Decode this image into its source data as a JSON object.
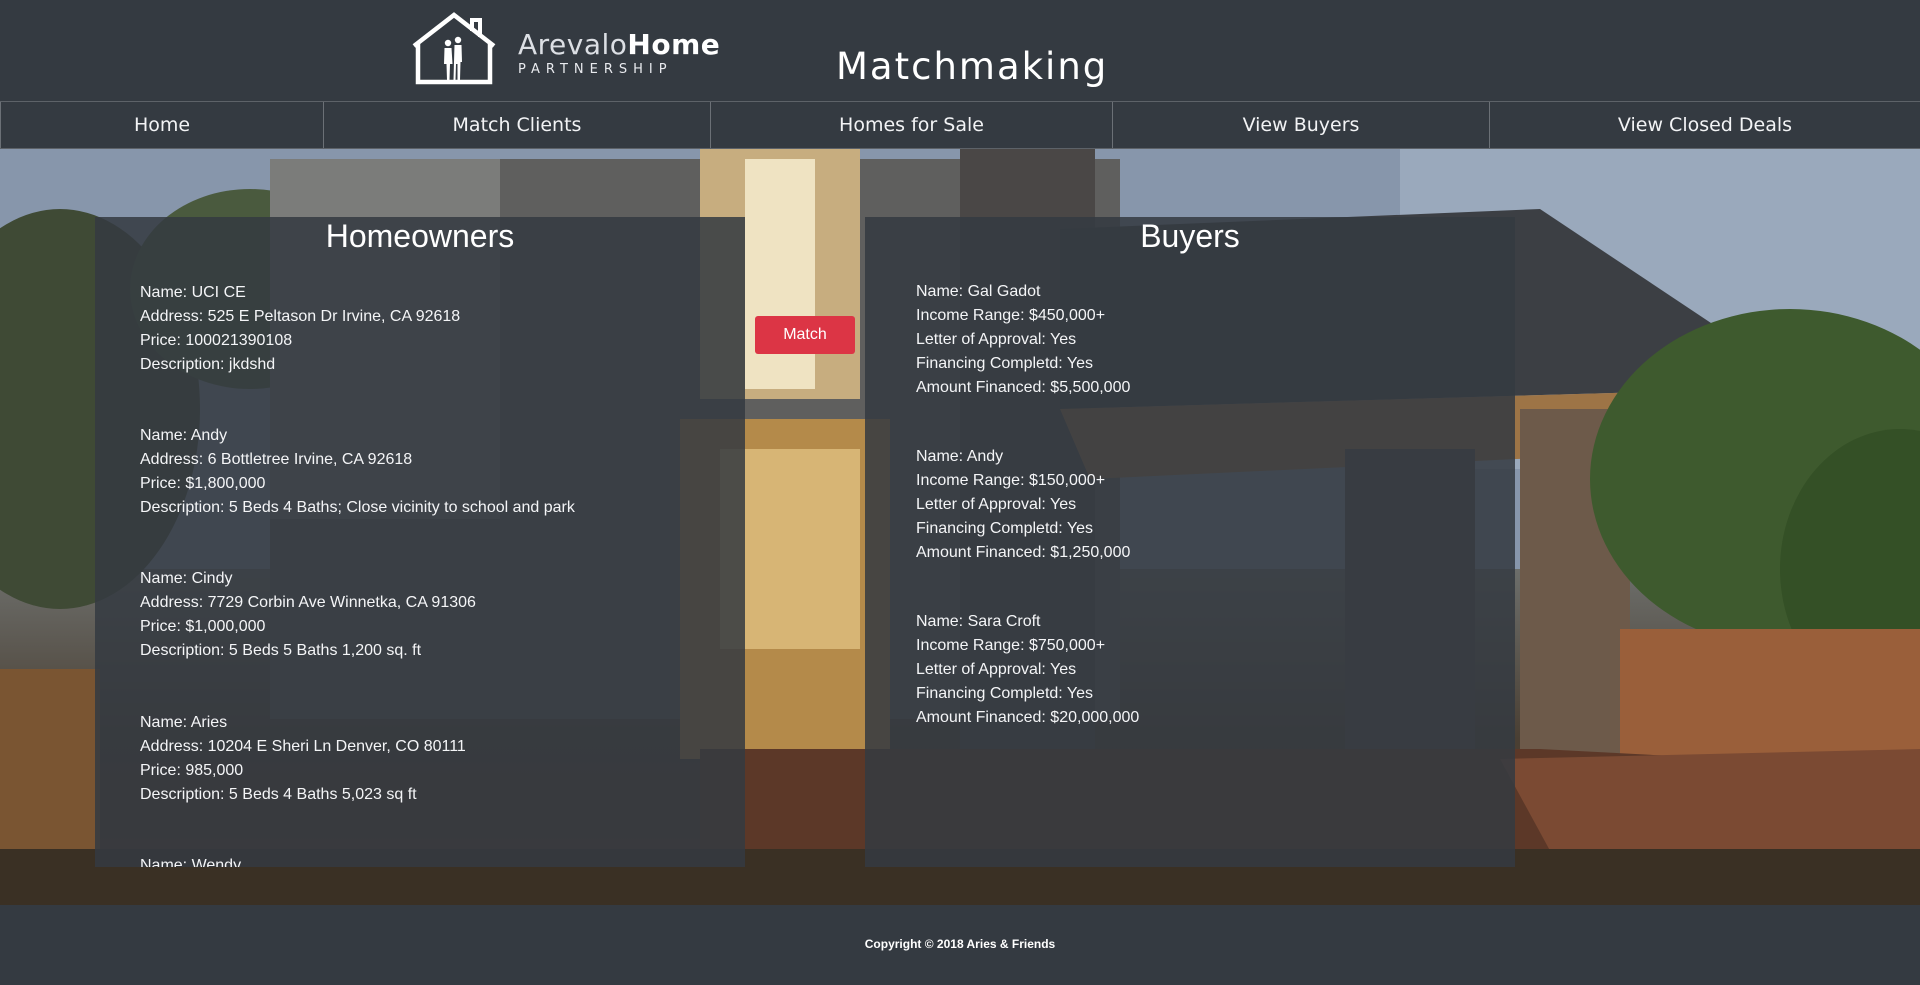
{
  "brand": {
    "logo_name_light": "Arevalo",
    "logo_name_bold": "Home",
    "logo_sub": "PARTNERSHIP",
    "accent": "#dc3545",
    "background": "#343a41"
  },
  "header": {
    "title": "Matchmaking"
  },
  "nav": {
    "items": [
      {
        "label": "Home"
      },
      {
        "label": "Match Clients"
      },
      {
        "label": "Homes for Sale"
      },
      {
        "label": "View Buyers"
      },
      {
        "label": "View Closed Deals"
      }
    ]
  },
  "homeowners": {
    "title": "Homeowners",
    "records": [
      {
        "name": "Name: UCI CE",
        "address": "Address: 525 E Peltason Dr Irvine, CA 92618",
        "price": "Price: 100021390108",
        "description": "Description: jkdshd"
      },
      {
        "name": "Name: Andy",
        "address": "Address: 6 Bottletree Irvine, CA 92618",
        "price": "Price: $1,800,000",
        "description": "Description: 5 Beds 4 Baths; Close vicinity to school and park"
      },
      {
        "name": "Name: Cindy",
        "address": "Address: 7729 Corbin Ave Winnetka, CA 91306",
        "price": "Price: $1,000,000",
        "description": "Description: 5 Beds 5 Baths 1,200 sq. ft"
      },
      {
        "name": "Name: Aries",
        "address": "Address: 10204 E Sheri Ln Denver, CO 80111",
        "price": "Price: 985,000",
        "description": "Description: 5 Beds 4 Baths 5,023 sq ft"
      },
      {
        "name": "Name: Wendy"
      }
    ]
  },
  "match_button": {
    "label": "Match"
  },
  "buyers": {
    "title": "Buyers",
    "records": [
      {
        "name": "Name: Gal Gadot",
        "income": "Income Range: $450,000+",
        "approval": "Letter of Approval: Yes",
        "financing": "Financing Completd: Yes",
        "amount": "Amount Financed: $5,500,000"
      },
      {
        "name": "Name: Andy",
        "income": "Income Range: $150,000+",
        "approval": "Letter of Approval: Yes",
        "financing": "Financing Completd: Yes",
        "amount": "Amount Financed: $1,250,000"
      },
      {
        "name": "Name: Sara Croft",
        "income": "Income Range: $750,000+",
        "approval": "Letter of Approval: Yes",
        "financing": "Financing Completd: Yes",
        "amount": "Amount Financed: $20,000,000"
      }
    ]
  },
  "footer": {
    "copyright": "Copyright © 2018 Aries & Friends"
  }
}
